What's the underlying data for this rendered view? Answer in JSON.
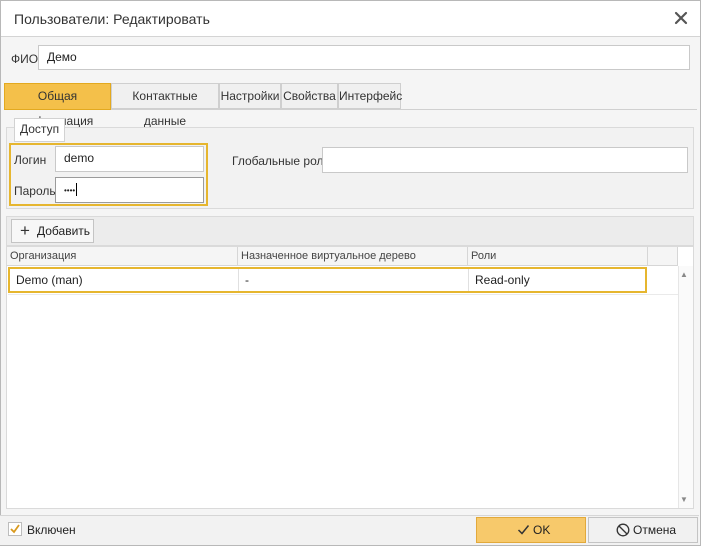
{
  "window": {
    "title": "Пользователи: Редактировать"
  },
  "fio": {
    "label": "ФИО",
    "value": "Демо"
  },
  "tabs": [
    {
      "label": "Общая информация",
      "active": true
    },
    {
      "label": "Контактные данные",
      "active": false
    },
    {
      "label": "Настройки",
      "active": false
    },
    {
      "label": "Свойства",
      "active": false
    },
    {
      "label": "Интерфейс",
      "active": false
    }
  ],
  "access": {
    "legend": "Доступ",
    "login_label": "Логин",
    "login_value": "demo",
    "password_label": "Пароль",
    "password_mask": "••••",
    "global_roles_label": "Глобальные роли",
    "global_roles_value": ""
  },
  "toolbar": {
    "add_label": "Добавить"
  },
  "grid": {
    "columns": [
      "Организация",
      "Назначенное виртуальное дерево",
      "Роли"
    ],
    "rows": [
      {
        "org": "Demo (man)",
        "tree": "-",
        "roles": "Read-only"
      }
    ]
  },
  "footer": {
    "enabled_label": "Включен",
    "enabled_checked": true,
    "ok_label": "OK",
    "cancel_label": "Отмена"
  },
  "colors": {
    "accent": "#f4c04a",
    "highlight_border": "#e6b62f",
    "ok_button": "#f7c96b"
  }
}
